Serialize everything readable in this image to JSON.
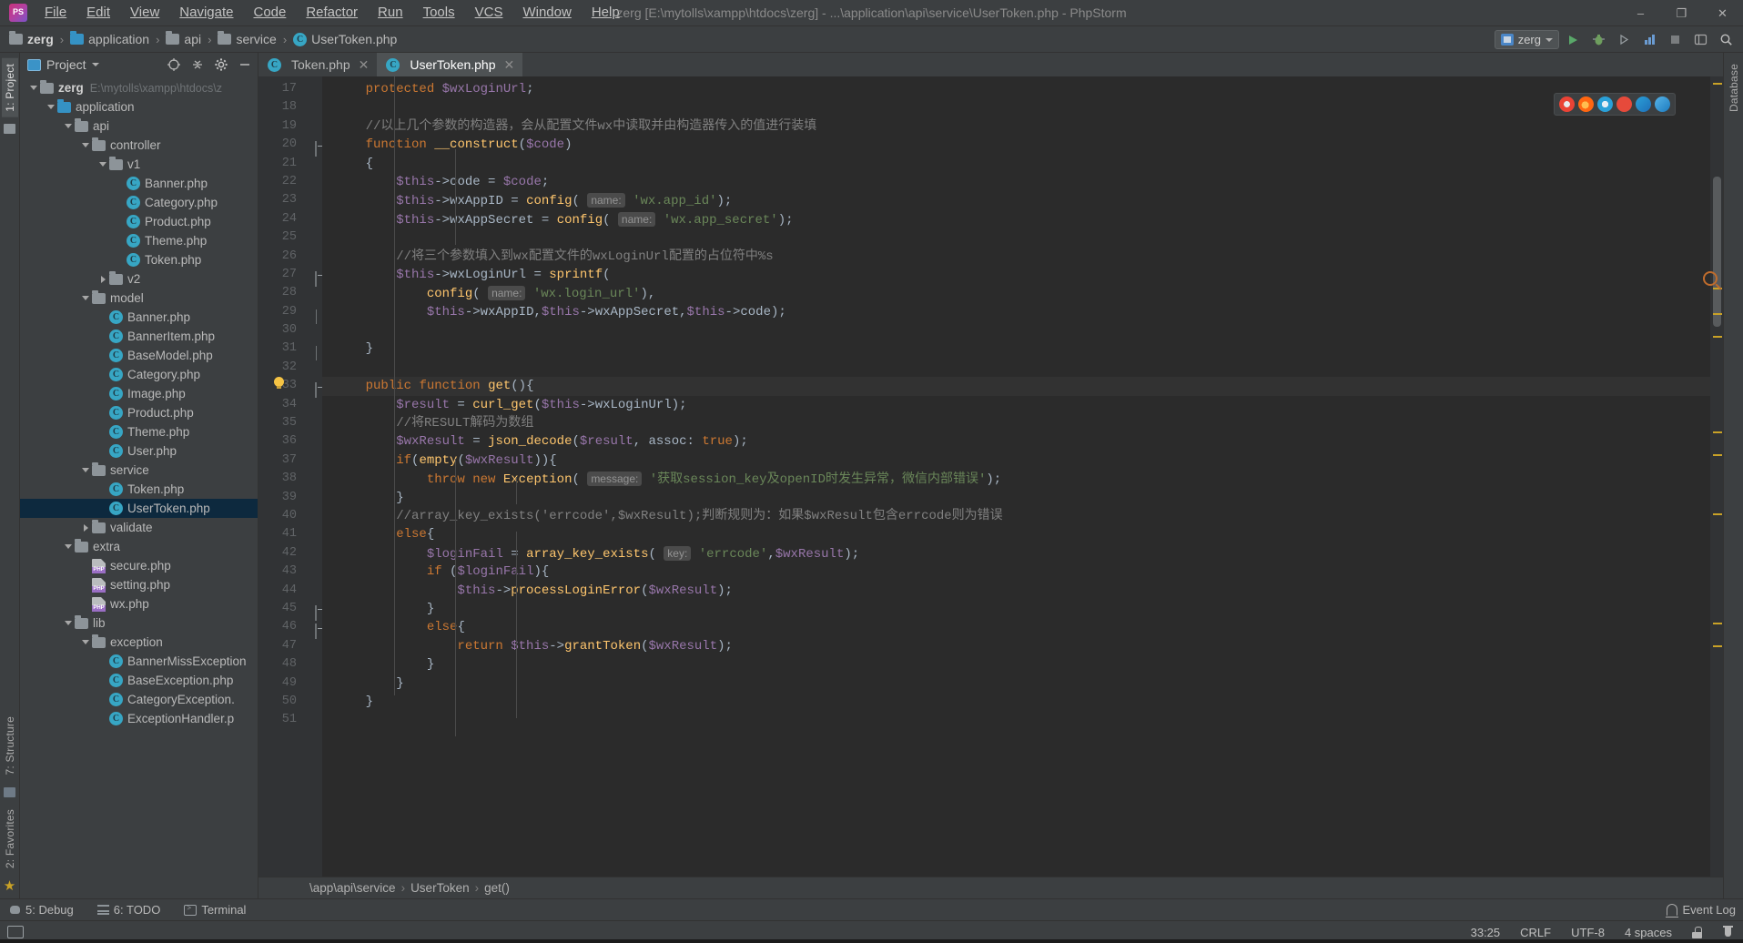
{
  "titlebar": {
    "app_icon": "phpstorm-logo",
    "title": "zerg [E:\\mytolls\\xampp\\htdocs\\zerg] - ...\\application\\api\\service\\UserToken.php - PhpStorm",
    "menus": [
      "File",
      "Edit",
      "View",
      "Navigate",
      "Code",
      "Refactor",
      "Run",
      "Tools",
      "VCS",
      "Window",
      "Help"
    ],
    "window_buttons": {
      "minimize": "–",
      "maximize": "❐",
      "close": "✕"
    }
  },
  "breadcrumbs": {
    "items": [
      {
        "label": "zerg",
        "icon": "folder-icon",
        "bold": true
      },
      {
        "label": "application",
        "icon": "folder-blue-icon",
        "bold": false
      },
      {
        "label": "api",
        "icon": "folder-icon",
        "bold": false
      },
      {
        "label": "service",
        "icon": "folder-icon",
        "bold": false
      },
      {
        "label": "UserToken.php",
        "icon": "php-class-icon",
        "bold": false
      }
    ],
    "separator": "›",
    "run_config": "zerg"
  },
  "left_strip": {
    "top_tab": "1: Project",
    "mid_tab": "7: Structure",
    "bottom_tab": "2: Favorites"
  },
  "right_strip": {
    "tab": "Database"
  },
  "project_panel": {
    "title": "Project",
    "toolbar_icons": [
      "target-locate-icon",
      "collapse-all-icon",
      "settings-gear-icon",
      "hide-panel-icon"
    ],
    "tree": [
      {
        "depth": 0,
        "label": "zerg",
        "icon": "folder-icon",
        "twisty": "down",
        "bold": true,
        "path": "E:\\mytolls\\xampp\\htdocs\\z"
      },
      {
        "depth": 1,
        "label": "application",
        "icon": "folder-blue-icon",
        "twisty": "down"
      },
      {
        "depth": 2,
        "label": "api",
        "icon": "folder-icon",
        "twisty": "down"
      },
      {
        "depth": 3,
        "label": "controller",
        "icon": "folder-icon",
        "twisty": "down"
      },
      {
        "depth": 4,
        "label": "v1",
        "icon": "folder-icon",
        "twisty": "down"
      },
      {
        "depth": 5,
        "label": "Banner.php",
        "icon": "php-class-icon",
        "twisty": "none"
      },
      {
        "depth": 5,
        "label": "Category.php",
        "icon": "php-class-icon",
        "twisty": "none"
      },
      {
        "depth": 5,
        "label": "Product.php",
        "icon": "php-class-icon",
        "twisty": "none"
      },
      {
        "depth": 5,
        "label": "Theme.php",
        "icon": "php-class-icon",
        "twisty": "none"
      },
      {
        "depth": 5,
        "label": "Token.php",
        "icon": "php-class-icon",
        "twisty": "none"
      },
      {
        "depth": 4,
        "label": "v2",
        "icon": "folder-icon",
        "twisty": "right"
      },
      {
        "depth": 3,
        "label": "model",
        "icon": "folder-icon",
        "twisty": "down"
      },
      {
        "depth": 4,
        "label": "Banner.php",
        "icon": "php-class-icon",
        "twisty": "none"
      },
      {
        "depth": 4,
        "label": "BannerItem.php",
        "icon": "php-class-icon",
        "twisty": "none"
      },
      {
        "depth": 4,
        "label": "BaseModel.php",
        "icon": "php-class-icon",
        "twisty": "none"
      },
      {
        "depth": 4,
        "label": "Category.php",
        "icon": "php-class-icon",
        "twisty": "none"
      },
      {
        "depth": 4,
        "label": "Image.php",
        "icon": "php-class-icon",
        "twisty": "none"
      },
      {
        "depth": 4,
        "label": "Product.php",
        "icon": "php-class-icon",
        "twisty": "none"
      },
      {
        "depth": 4,
        "label": "Theme.php",
        "icon": "php-class-icon",
        "twisty": "none"
      },
      {
        "depth": 4,
        "label": "User.php",
        "icon": "php-class-icon",
        "twisty": "none"
      },
      {
        "depth": 3,
        "label": "service",
        "icon": "folder-icon",
        "twisty": "down"
      },
      {
        "depth": 4,
        "label": "Token.php",
        "icon": "php-class-icon",
        "twisty": "none"
      },
      {
        "depth": 4,
        "label": "UserToken.php",
        "icon": "php-class-icon",
        "twisty": "none",
        "selected": true
      },
      {
        "depth": 3,
        "label": "validate",
        "icon": "folder-icon",
        "twisty": "right"
      },
      {
        "depth": 2,
        "label": "extra",
        "icon": "folder-icon",
        "twisty": "down"
      },
      {
        "depth": 3,
        "label": "secure.php",
        "icon": "php-file-icon",
        "twisty": "none"
      },
      {
        "depth": 3,
        "label": "setting.php",
        "icon": "php-file-icon",
        "twisty": "none"
      },
      {
        "depth": 3,
        "label": "wx.php",
        "icon": "php-file-icon",
        "twisty": "none"
      },
      {
        "depth": 2,
        "label": "lib",
        "icon": "folder-icon",
        "twisty": "down"
      },
      {
        "depth": 3,
        "label": "exception",
        "icon": "folder-icon",
        "twisty": "down"
      },
      {
        "depth": 4,
        "label": "BannerMissException",
        "icon": "php-class-icon",
        "twisty": "none"
      },
      {
        "depth": 4,
        "label": "BaseException.php",
        "icon": "php-class-icon",
        "twisty": "none"
      },
      {
        "depth": 4,
        "label": "CategoryException.",
        "icon": "php-class-icon",
        "twisty": "none"
      },
      {
        "depth": 4,
        "label": "ExceptionHandler.p",
        "icon": "php-class-icon",
        "twisty": "none"
      }
    ]
  },
  "editor": {
    "tabs": [
      {
        "label": "Token.php",
        "icon": "php-class-icon",
        "active": false,
        "close": "✕"
      },
      {
        "label": "UserToken.php",
        "icon": "php-class-icon",
        "active": true,
        "close": "✕"
      }
    ],
    "first_line_number": 17,
    "lines": [
      {
        "n": 17,
        "text": "    protected $wxLoginUrl;",
        "fold": "none"
      },
      {
        "n": 18,
        "text": "",
        "fold": "none"
      },
      {
        "n": 19,
        "text": "    //以上几个参数的构造器，会从配置文件wx中读取并由构造器传入的值进行装填",
        "fold": "none"
      },
      {
        "n": 20,
        "text": "    function __construct($code)",
        "fold": "box"
      },
      {
        "n": 21,
        "text": "    {",
        "fold": "none"
      },
      {
        "n": 22,
        "text": "        $this->code = $code;",
        "fold": "none"
      },
      {
        "n": 23,
        "text": "        $this->wxAppID = config( name: 'wx.app_id');",
        "fold": "none"
      },
      {
        "n": 24,
        "text": "        $this->wxAppSecret = config( name: 'wx.app_secret');",
        "fold": "none"
      },
      {
        "n": 25,
        "text": "",
        "fold": "none"
      },
      {
        "n": 26,
        "text": "        //将三个参数填入到wx配置文件的wxLoginUrl配置的占位符中%s",
        "fold": "none"
      },
      {
        "n": 27,
        "text": "        $this->wxLoginUrl = sprintf(",
        "fold": "box"
      },
      {
        "n": 28,
        "text": "            config( name: 'wx.login_url'),",
        "fold": "none"
      },
      {
        "n": 29,
        "text": "            $this->wxAppID,$this->wxAppSecret,$this->code);",
        "fold": "chev"
      },
      {
        "n": 30,
        "text": "",
        "fold": "none"
      },
      {
        "n": 31,
        "text": "    }",
        "fold": "chev"
      },
      {
        "n": 32,
        "text": "",
        "fold": "none"
      },
      {
        "n": 33,
        "text": "    public function get(){",
        "fold": "box",
        "bulb": true,
        "highlight": true
      },
      {
        "n": 34,
        "text": "        $result = curl_get($this->wxLoginUrl);",
        "fold": "none"
      },
      {
        "n": 35,
        "text": "        //将RESULT解码为数组",
        "fold": "none"
      },
      {
        "n": 36,
        "text": "        $wxResult = json_decode($result, assoc: true);",
        "fold": "none"
      },
      {
        "n": 37,
        "text": "        if(empty($wxResult)){",
        "fold": "none"
      },
      {
        "n": 38,
        "text": "            throw new Exception( message: '获取session_key及openID时发生异常，微信内部错误');",
        "fold": "none"
      },
      {
        "n": 39,
        "text": "        }",
        "fold": "none"
      },
      {
        "n": 40,
        "text": "        //array_key_exists('errcode',$wxResult);判断规则为：如果$wxResult包含errcode则为错误",
        "fold": "none"
      },
      {
        "n": 41,
        "text": "        else{",
        "fold": "none"
      },
      {
        "n": 42,
        "text": "            $loginFail = array_key_exists( key: 'errcode',$wxResult);",
        "fold": "none"
      },
      {
        "n": 43,
        "text": "            if ($loginFail){",
        "fold": "none"
      },
      {
        "n": 44,
        "text": "                $this->processLoginError($wxResult);",
        "fold": "none"
      },
      {
        "n": 45,
        "text": "            }",
        "fold": "box"
      },
      {
        "n": 46,
        "text": "            else{",
        "fold": "box"
      },
      {
        "n": 47,
        "text": "                return $this->grantToken($wxResult);",
        "fold": "none"
      },
      {
        "n": 48,
        "text": "            }",
        "fold": "none"
      },
      {
        "n": 49,
        "text": "        }",
        "fold": "none"
      },
      {
        "n": 50,
        "text": "    }",
        "fold": "none"
      },
      {
        "n": 51,
        "text": "",
        "fold": "none"
      }
    ],
    "breadcrumb_footer": [
      "\\app\\api\\service",
      "UserToken",
      "get()"
    ],
    "breadcrumb_sep": "›",
    "browser_icons": [
      "chrome-icon",
      "firefox-icon",
      "safari-icon",
      "opera-icon",
      "edge-icon",
      "ie-icon"
    ]
  },
  "bottom_bar": {
    "items": [
      {
        "label": "5: Debug",
        "icon": "debug-icon",
        "mnemonic": "5"
      },
      {
        "label": "6: TODO",
        "icon": "todo-icon",
        "mnemonic": "6"
      },
      {
        "label": "Terminal",
        "icon": "terminal-icon",
        "mnemonic": ""
      }
    ],
    "event_log": "Event Log"
  },
  "status_bar": {
    "caret": "33:25",
    "line_separator": "CRLF",
    "encoding": "UTF-8",
    "indent": "4 spaces",
    "lock_icon": "lock-icon",
    "inspection_icon": "inspector-hat-icon"
  },
  "colors": {
    "chrome_bg": "#3c3f41",
    "editor_bg": "#2b2b2b",
    "gutter_bg": "#313335",
    "selection": "#0d293e",
    "accent_blue": "#3592c4",
    "keyword_orange": "#cc7832",
    "variable_purple": "#9876aa",
    "string_green": "#6a8759",
    "function_yellow": "#ffc66d",
    "comment_gray": "#808080",
    "text_default": "#a9b7c6"
  }
}
